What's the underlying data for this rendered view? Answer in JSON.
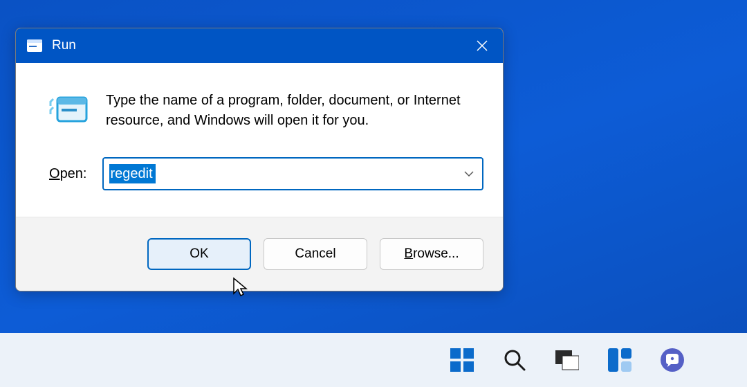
{
  "dialog": {
    "title": "Run",
    "description": "Type the name of a program, folder, document, or Internet resource, and Windows will open it for you.",
    "open_label_prefix": "O",
    "open_label_rest": "pen:",
    "input_value": "regedit",
    "buttons": {
      "ok": "OK",
      "cancel": "Cancel",
      "browse_prefix": "B",
      "browse_rest": "rowse..."
    }
  }
}
